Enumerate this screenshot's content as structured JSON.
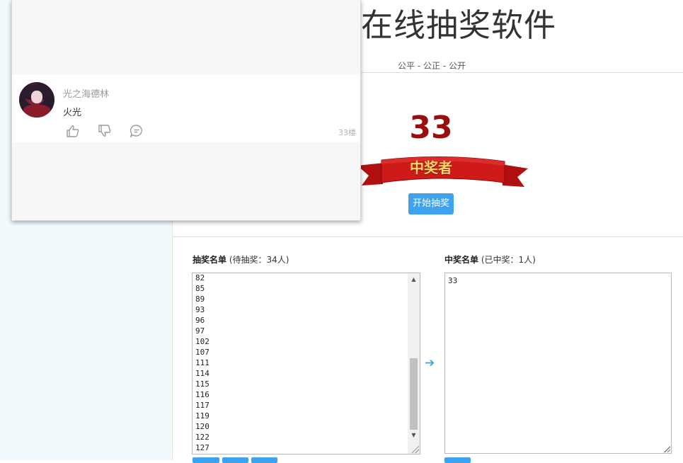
{
  "header": {
    "title": "在线抽奖软件",
    "subtitle": "公平 - 公正 - 公开"
  },
  "draw": {
    "winner_number": "33",
    "ribbon_label": "中奖者",
    "start_button": "开始抽奖"
  },
  "pending_list": {
    "label_bold": "抽奖名单",
    "label_count": "(待抽奖：34人)",
    "items": [
      "82",
      "85",
      "89",
      "93",
      "96",
      "97",
      "102",
      "107",
      "111",
      "114",
      "115",
      "116",
      "117",
      "119",
      "120",
      "122",
      "127"
    ]
  },
  "winner_list": {
    "label_bold": "中奖名单",
    "label_count": "(已中奖：1人)",
    "items": [
      "33"
    ]
  },
  "comment_popup": {
    "username": "光之海德林",
    "text": "火光",
    "floor": "33楼"
  },
  "colors": {
    "accent_blue": "#3fa2ef",
    "winner_red": "#9b0c0c",
    "left_panel_bg": "#f2fafe"
  },
  "icons": {
    "like": "thumb-up-icon",
    "dislike": "thumb-down-icon",
    "reply": "comment-icon",
    "transfer": "arrow-right-icon"
  }
}
